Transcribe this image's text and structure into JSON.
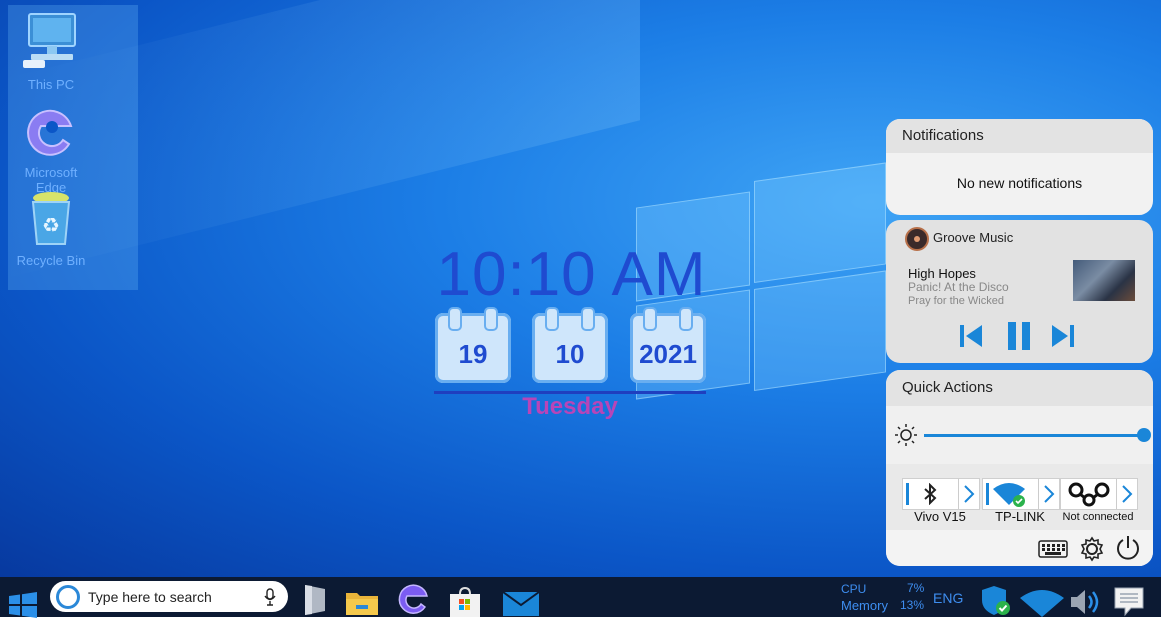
{
  "desktop": {
    "icons": [
      {
        "label": "This PC",
        "icon": "computer-icon"
      },
      {
        "label": "Microsoft Edge",
        "icon": "edge-icon"
      },
      {
        "label": "Recycle Bin",
        "icon": "recycle-bin-icon"
      }
    ]
  },
  "clock": {
    "time": "10:10 AM",
    "day": "19",
    "month": "10",
    "year": "2021",
    "weekday": "Tuesday"
  },
  "notifications": {
    "title": "Notifications",
    "empty_text": "No new notifications"
  },
  "music": {
    "app": "Groove Music",
    "song": "High Hopes",
    "artist": "Panic! At the Disco",
    "album": "Pray for the Wicked"
  },
  "quick_actions": {
    "title": "Quick Actions",
    "brightness_percent": 100,
    "tiles": [
      {
        "label": "Vivo V15",
        "icon": "bluetooth-icon"
      },
      {
        "label": "TP-LINK",
        "icon": "wifi-icon"
      },
      {
        "label": "Not connected",
        "icon": "mobile-hotspot-icon"
      }
    ]
  },
  "taskbar": {
    "search_placeholder": "Type here to search",
    "cpu_label": "CPU",
    "cpu_value": "7%",
    "memory_label": "Memory",
    "memory_value": "13%",
    "language": "ENG"
  },
  "colors": {
    "accent": "#1a86d8",
    "clock_text": "#1f4bd0",
    "weekday": "#b845b8",
    "taskbar": "#0c1a33"
  }
}
